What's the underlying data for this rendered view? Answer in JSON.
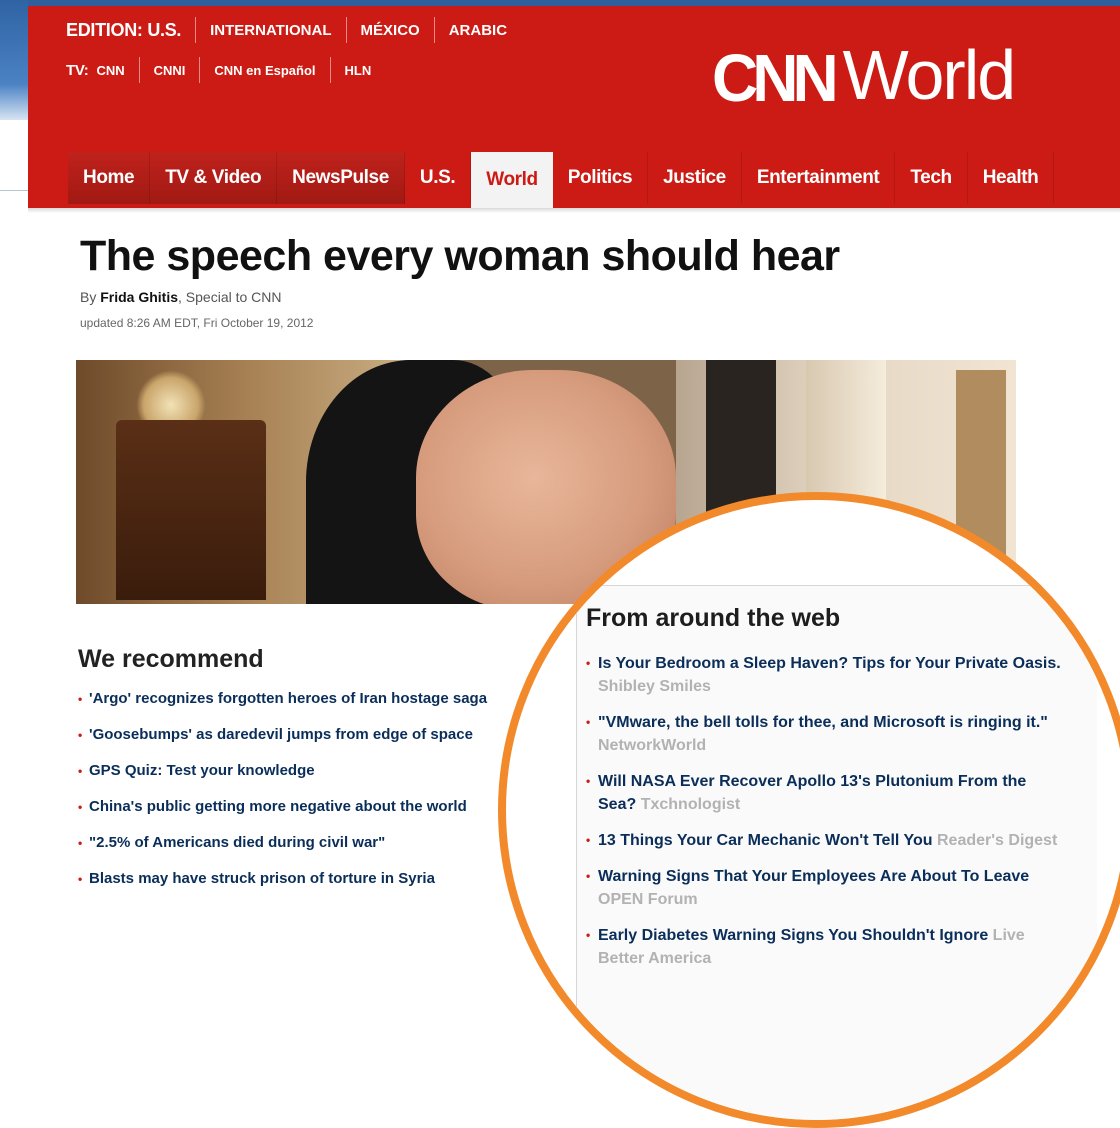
{
  "edition": {
    "label": "EDITION:",
    "current": "U.S.",
    "links": [
      "INTERNATIONAL",
      "MÉXICO",
      "ARABIC"
    ]
  },
  "tv": {
    "label": "TV:",
    "links": [
      "CNN",
      "CNNI",
      "CNN en Español",
      "HLN"
    ]
  },
  "logo": {
    "brand": "CNN",
    "section": "World"
  },
  "nav": {
    "items": [
      "Home",
      "TV & Video",
      "NewsPulse",
      "U.S.",
      "World",
      "Politics",
      "Justice",
      "Entertainment",
      "Tech",
      "Health"
    ],
    "active": "World"
  },
  "article": {
    "headline": "The speech every woman should hear",
    "by_prefix": "By",
    "author": "Frida Ghitis",
    "author_role": ", Special to CNN",
    "updated": "updated 8:26 AM EDT, Fri October 19, 2012"
  },
  "recommend": {
    "title": "We recommend",
    "items": [
      "'Argo' recognizes forgotten heroes of Iran hostage saga",
      "'Goosebumps' as daredevil jumps from edge of space",
      "GPS Quiz: Test your knowledge",
      "China's public getting more negative about the world",
      "\"2.5% of Americans died during civil war\"",
      "Blasts may have struck prison of torture in Syria"
    ]
  },
  "around_web": {
    "title": "From around the web",
    "items": [
      {
        "text": "Is Your Bedroom a Sleep Haven? Tips for Your Private Oasis.",
        "source": "Shibley Smiles"
      },
      {
        "text": "\"VMware, the bell tolls for thee, and Microsoft is ringing it.\"",
        "source": "NetworkWorld"
      },
      {
        "text": "Will NASA Ever Recover Apollo 13's Plutonium From the Sea?",
        "source": "Txchnologist"
      },
      {
        "text": "13 Things Your Car Mechanic Won't Tell You",
        "source": "Reader's Digest"
      },
      {
        "text": "Warning Signs That Your Employees Are About To Leave",
        "source": "OPEN Forum"
      },
      {
        "text": "Early Diabetes Warning Signs You Shouldn't Ignore",
        "source": "Live Better America"
      }
    ]
  },
  "colors": {
    "cnn_red": "#cc1b14",
    "link_navy": "#0a2e59",
    "highlight_orange": "#f28a2b"
  }
}
